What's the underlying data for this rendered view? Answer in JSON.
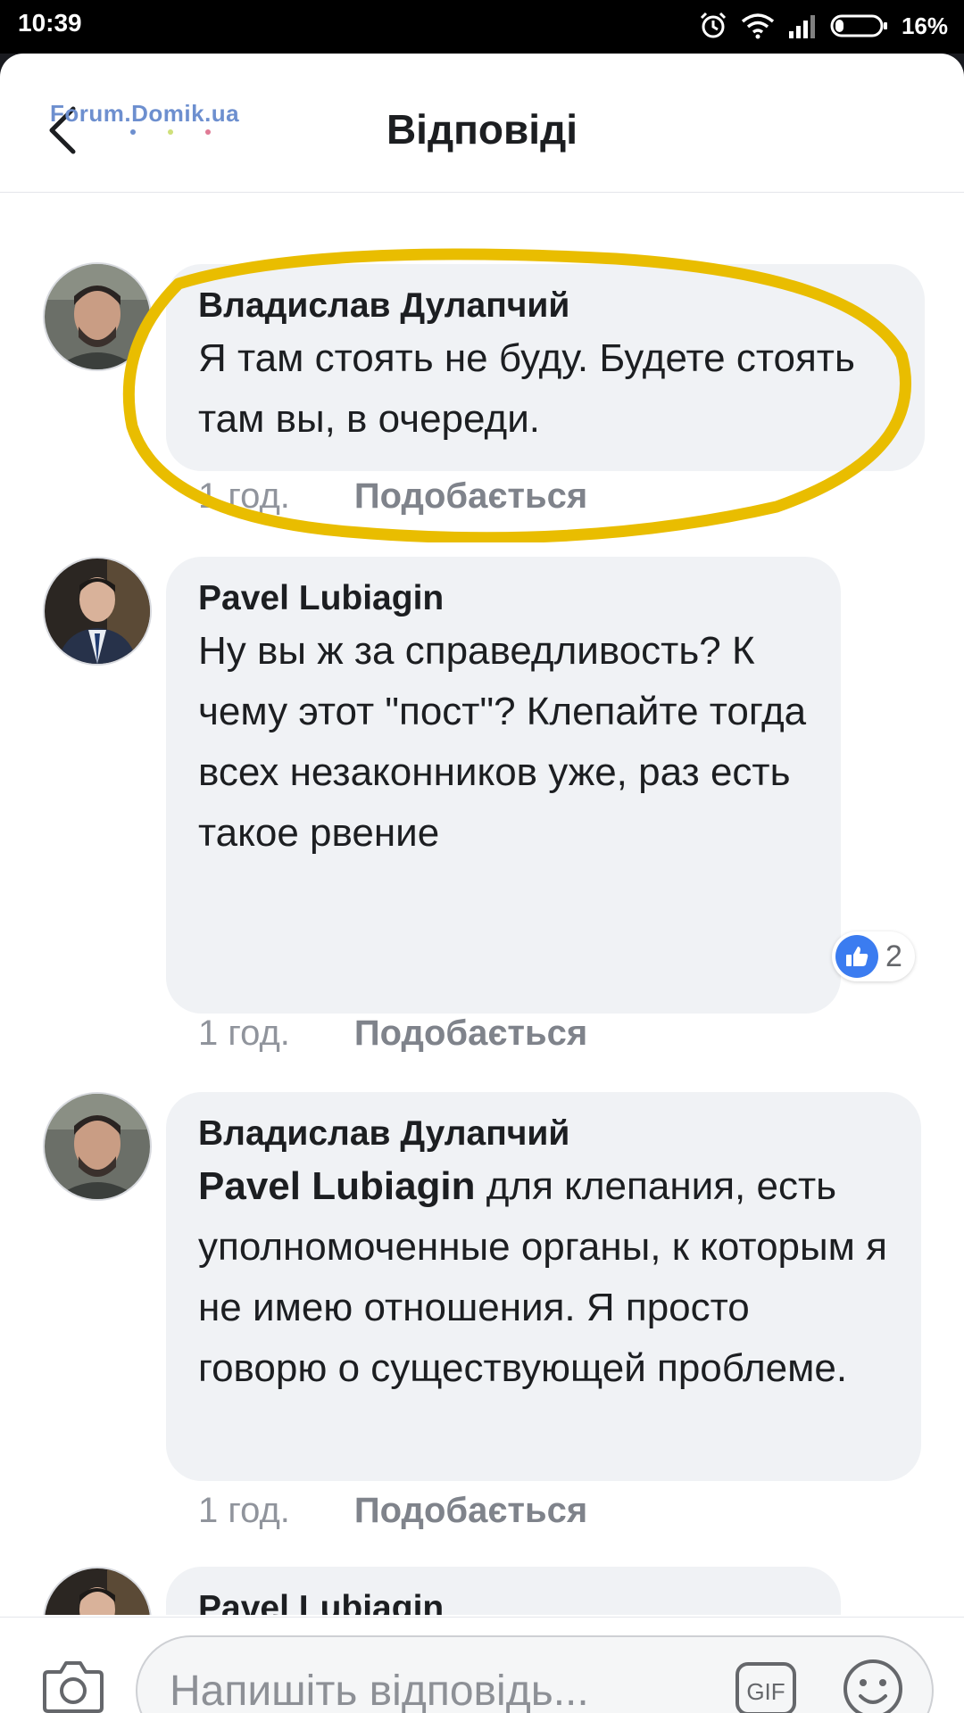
{
  "status_bar": {
    "time": "10:39",
    "battery": "16%"
  },
  "watermark": {
    "text": "Forum.Domik.ua"
  },
  "header": {
    "title": "Відповіді"
  },
  "comments": [
    {
      "author": "Владислав Дулапчий",
      "text": "Я там стоять не буду. Будете стоять там вы, в очереди.",
      "time": "1 год.",
      "like_label": "Подобається"
    },
    {
      "author": "Pavel Lubiagin",
      "text": "Ну вы ж за справедливость? К чему этот \"пост\"? Клепайте тогда всех незаконников уже, раз есть такое рвение",
      "time": "1 год.",
      "like_label": "Подобається",
      "reactions": {
        "icon": "thumbs-up-icon",
        "count": "2"
      }
    },
    {
      "author": "Владислав Дулапчий",
      "mention": "Pavel Lubiagin",
      "text": " для клепания, есть уполномоченные органы, к которым я не имею отношения. Я просто говорю о существующей проблеме.",
      "time": "1 год.",
      "like_label": "Подобається"
    },
    {
      "author": "Pavel Lubiagin"
    }
  ],
  "composer": {
    "placeholder": "Напишіть відповідь...",
    "gif_label": "GIF"
  },
  "colors": {
    "highlight": "#e9bd00",
    "accent": "#3b7cf0",
    "watermark": "#6d8fcf"
  }
}
